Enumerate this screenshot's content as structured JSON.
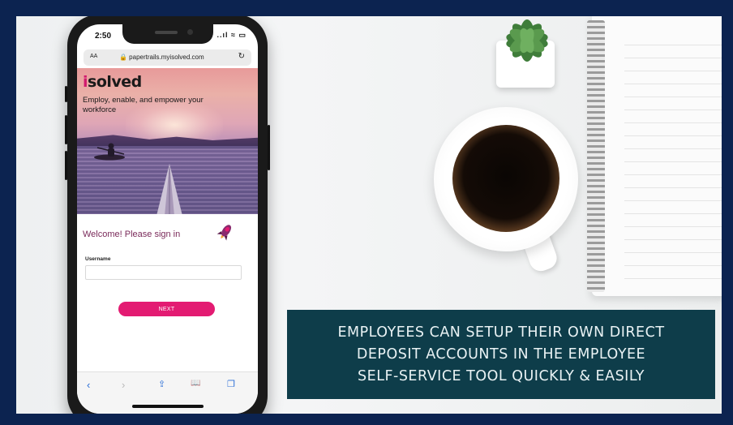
{
  "phone": {
    "status_time": "2:50",
    "status_icons": "..ıl ≈ ▭",
    "url_aa": "AA",
    "url": "🔒 papertrails.myisolved.com",
    "reload_icon": "↻",
    "logo_prefix": "i",
    "logo_text": "solved",
    "tagline": "Employ, enable, and empower your workforce",
    "welcome": "Welcome! Please sign in",
    "username_label": "Username",
    "username_value": "",
    "next_label": "NEXT",
    "toolbar": {
      "back": "‹",
      "forward": "›",
      "share": "⇪",
      "bookmarks": "📖",
      "tabs": "❐"
    }
  },
  "caption": {
    "line1": "EMPLOYEES CAN SETUP THEIR OWN DIRECT",
    "line2": "DEPOSIT ACCOUNTS IN THE EMPLOYEE",
    "line3": "SELF-SERVICE TOOL QUICKLY & EASILY"
  },
  "colors": {
    "frame": "#0c2350",
    "caption_bg": "#0e3d4a",
    "accent_pink": "#e31b72",
    "link_blue": "#2a6ed6"
  }
}
